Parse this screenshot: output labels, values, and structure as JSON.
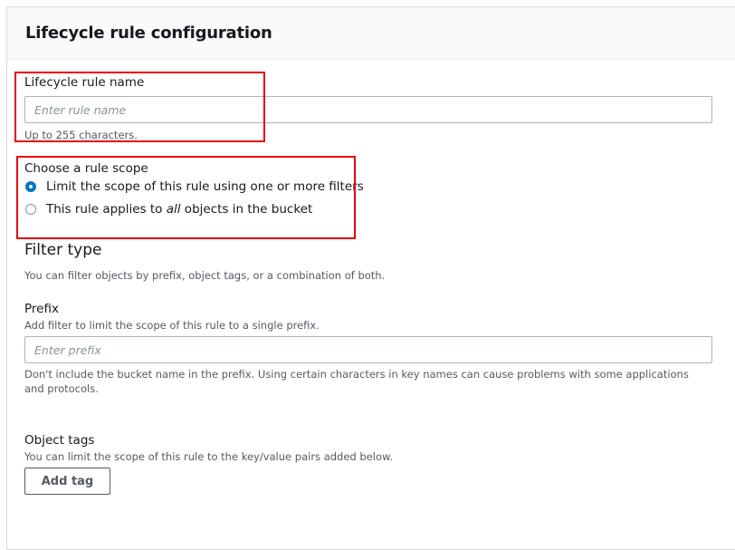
{
  "section": {
    "title": "Lifecycle rule configuration"
  },
  "rule_name": {
    "label": "Lifecycle rule name",
    "placeholder": "Enter rule name",
    "value": "",
    "hint": "Up to 255 characters."
  },
  "scope": {
    "label": "Choose a rule scope",
    "options": [
      {
        "label": "Limit the scope of this rule using one or more filters",
        "selected": true
      },
      {
        "label_before": "This rule applies to ",
        "label_emphasis": "all",
        "label_after": " objects in the bucket",
        "selected": false
      }
    ]
  },
  "filter_type": {
    "heading": "Filter type",
    "description": "You can filter objects by prefix, object tags, or a combination of both."
  },
  "prefix": {
    "label": "Prefix",
    "description": "Add filter to limit the scope of this rule to a single prefix.",
    "placeholder": "Enter prefix",
    "value": "",
    "hint": "Don't include the bucket name in the prefix. Using certain characters in key names can cause problems with some applications and protocols."
  },
  "object_tags": {
    "label": "Object tags",
    "description": "You can limit the scope of this rule to the key/value pairs added below.",
    "add_button": "Add tag"
  },
  "colors": {
    "accent": "#0073bb",
    "highlight_box": "#e3000f",
    "text_primary": "#16191f",
    "text_secondary": "#545b64",
    "placeholder": "#879596",
    "border": "#aab7b8"
  }
}
